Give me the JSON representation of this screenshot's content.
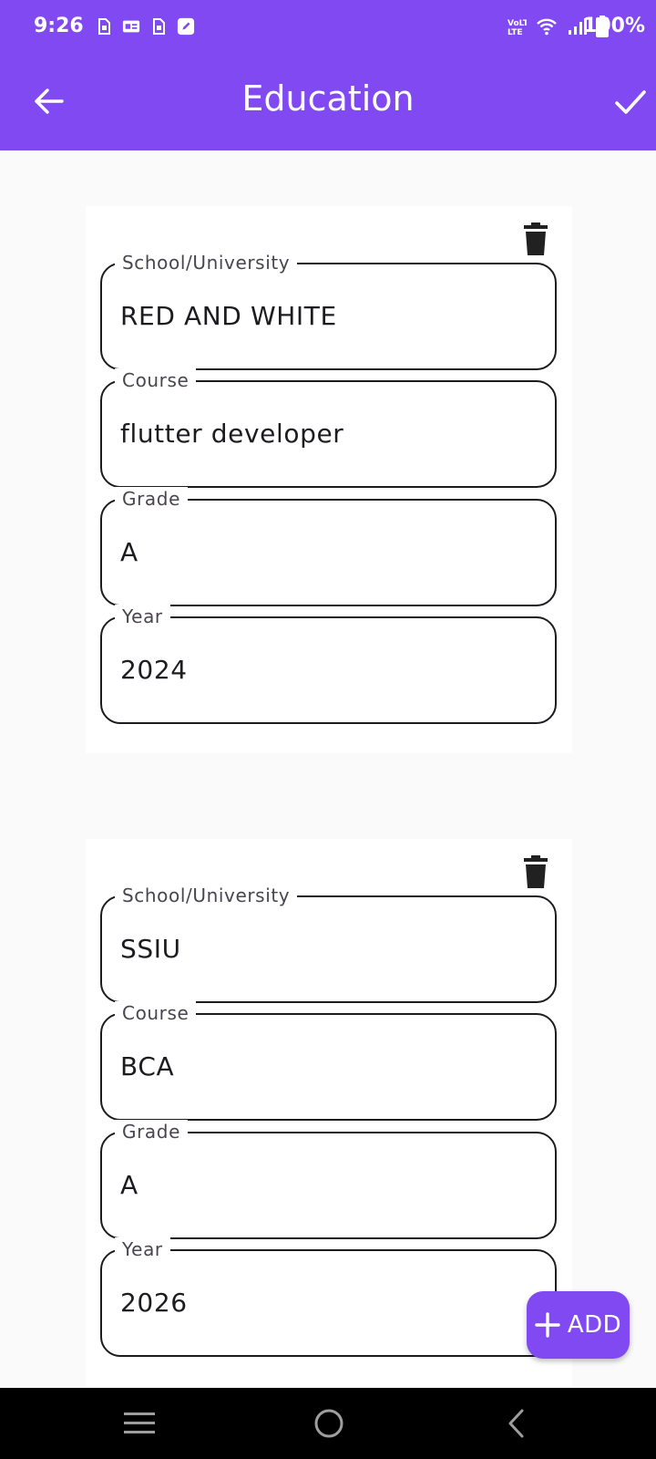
{
  "status_bar": {
    "time": "9:26",
    "battery": "100%",
    "notification_icons": [
      "sim-icon",
      "id-card-icon",
      "sim-icon",
      "edit-note-icon"
    ],
    "system_icons": [
      "volte-icon",
      "wifi-icon",
      "signal-icon",
      "battery-icon"
    ]
  },
  "app_bar": {
    "title": "Education",
    "back_icon": "arrow-left-icon",
    "save_icon": "check-icon"
  },
  "education_entries": [
    {
      "school_label": "School/University",
      "school_value": "RED AND WHITE",
      "course_label": "Course",
      "course_value": "flutter developer",
      "grade_label": "Grade",
      "grade_value": "A",
      "year_label": "Year",
      "year_value": "2024"
    },
    {
      "school_label": "School/University",
      "school_value": "SSIU",
      "course_label": "Course",
      "course_value": "BCA",
      "grade_label": "Grade",
      "grade_value": "A",
      "year_label": "Year",
      "year_value": "2026"
    }
  ],
  "fab": {
    "label": "ADD",
    "icon": "plus-icon"
  },
  "colors": {
    "primary": "#8049f2",
    "background": "#fafafa",
    "card": "#ffffff",
    "outline": "#1c1b1f"
  }
}
